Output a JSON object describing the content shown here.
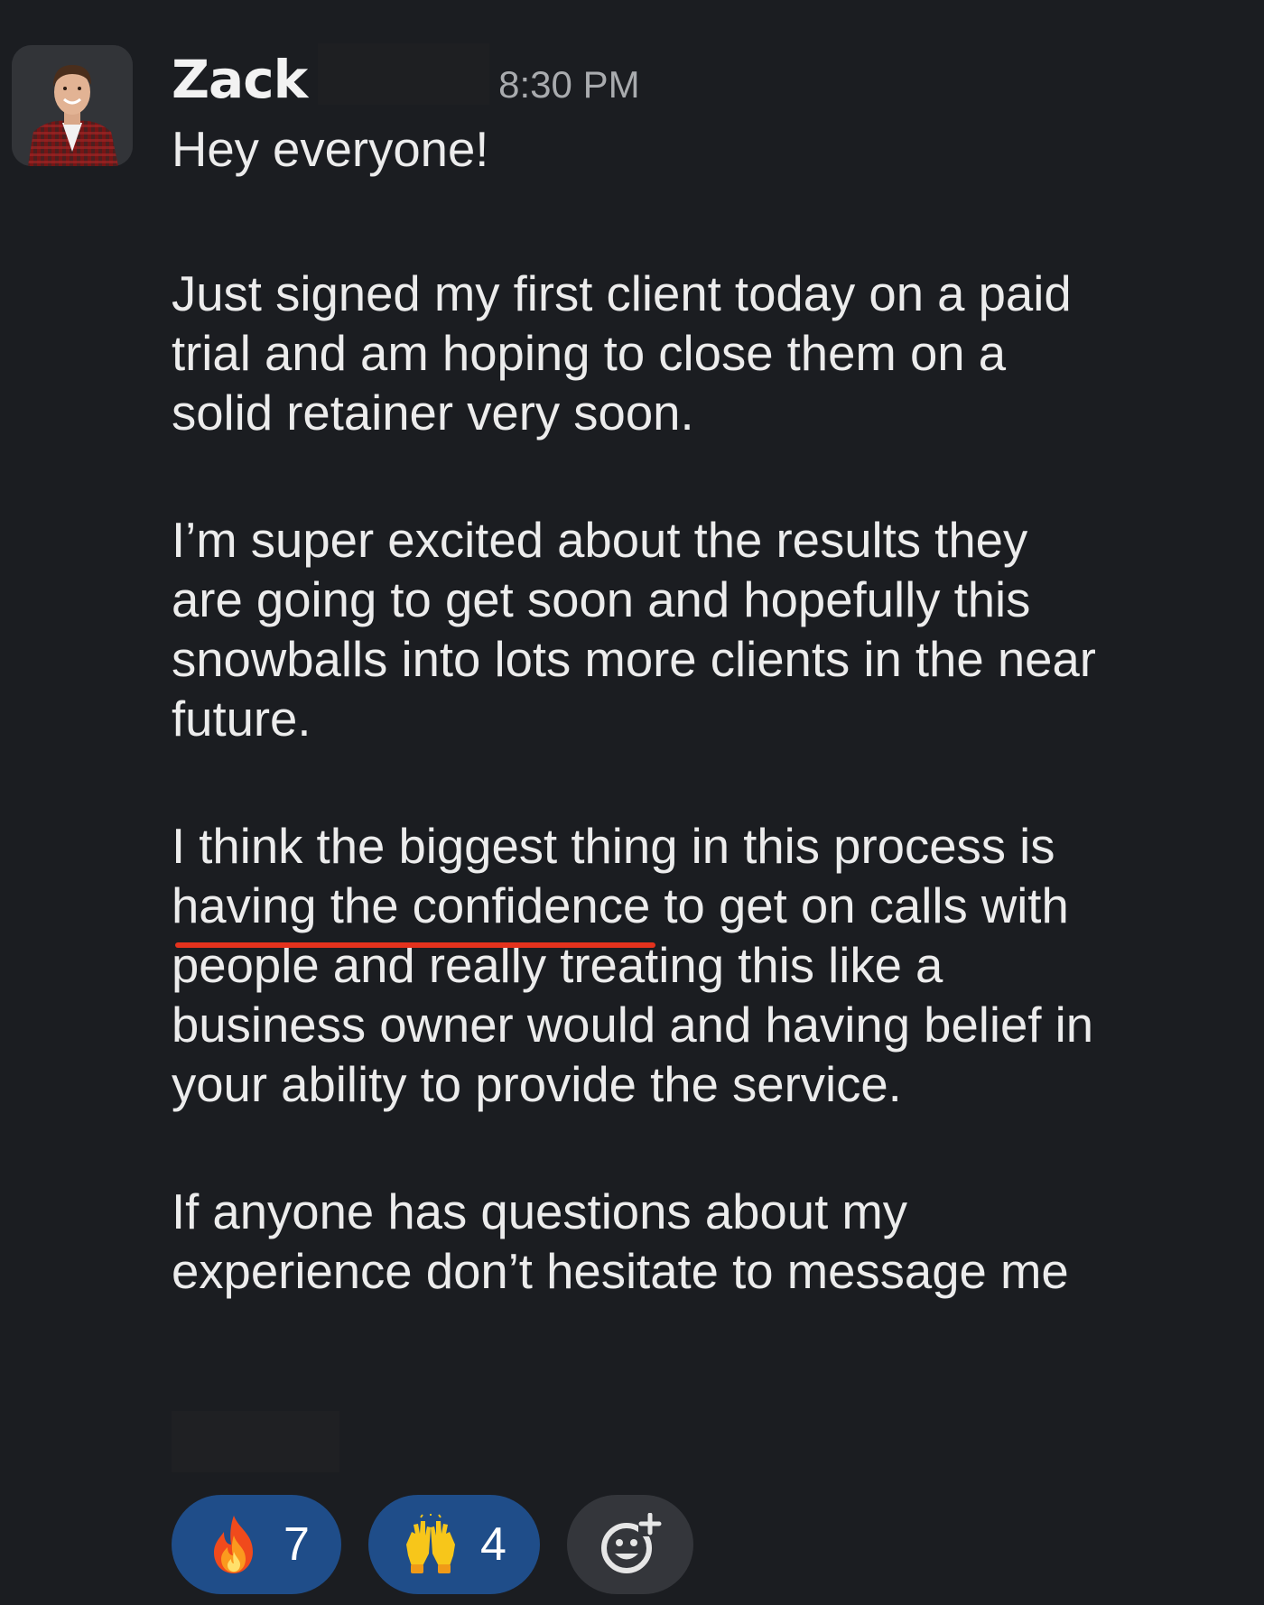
{
  "message": {
    "author": "Zack",
    "timestamp": "8:30 PM",
    "lines": {
      "l1": "Hey everyone!",
      "l2": "Just signed my first client today on a paid",
      "l3": "trial and am hoping to close them on a",
      "l4": "solid retainer very soon.",
      "l5": "I’m super excited about the results they",
      "l6": "are going to get soon and hopefully this",
      "l7": "snowballs into lots more clients in the near",
      "l8": "future.",
      "l9": "I think the biggest thing in this process is",
      "l10_underlined": "having the confidence",
      "l10_rest": " to get on calls with",
      "l11": "people and really treating this like a",
      "l12": "business owner would and having belief in",
      "l13": "your ability to provide the service.",
      "l14": "If anyone has questions about my",
      "l15": "experience don’t hesitate to message me"
    }
  },
  "reactions": [
    {
      "icon": "fire-emoji-icon",
      "count": "7"
    },
    {
      "icon": "raised-hands-emoji-icon",
      "count": "4"
    }
  ],
  "colors": {
    "background": "#1b1d21",
    "reaction_active": "#1f4d89",
    "reaction_add": "#34363b",
    "underline": "#e4321d"
  }
}
